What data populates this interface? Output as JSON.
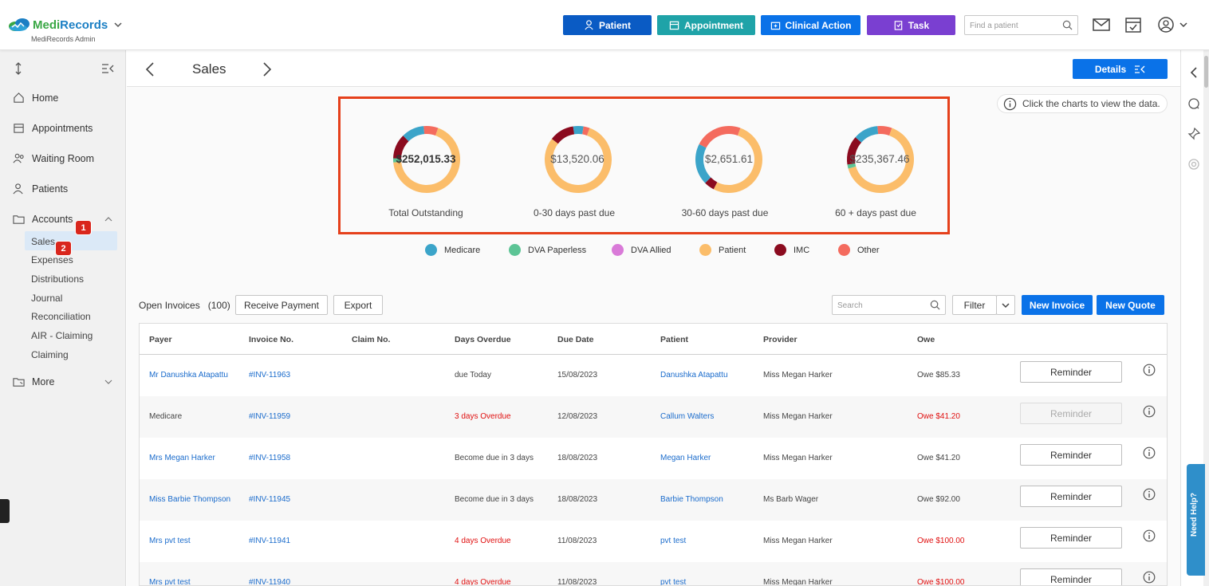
{
  "header": {
    "logo_text_medi": "Medi",
    "logo_text_records": "Records",
    "logo_subtitle": "MediRecords Admin",
    "buttons": {
      "patient": "Patient",
      "appointment": "Appointment",
      "clinical_action": "Clinical Action",
      "task": "Task"
    },
    "find_placeholder": "Find a patient",
    "colors": {
      "patient": "#0a5bc4",
      "appointment": "#1fa3a8",
      "clinical_action": "#0a72e8",
      "task": "#7a3fd1"
    }
  },
  "sidebar": {
    "items": {
      "home": "Home",
      "appointments": "Appointments",
      "waiting_room": "Waiting Room",
      "patients": "Patients",
      "accounts": "Accounts",
      "more": "More"
    },
    "accounts_sub": {
      "sales": "Sales",
      "expenses": "Expenses",
      "distributions": "Distributions",
      "journal": "Journal",
      "reconciliation": "Reconciliation",
      "air_claiming": "AIR - Claiming",
      "claiming": "Claiming"
    },
    "badges": {
      "one": "1",
      "two": "2"
    }
  },
  "page": {
    "title": "Sales",
    "details_label": "Details",
    "hint": "Click the charts to view the data."
  },
  "chart_data": [
    {
      "type": "pie",
      "title": "Total Outstanding",
      "center_label": "$252,015.33",
      "series": [
        {
          "name": "Patient",
          "value": 0.68
        },
        {
          "name": "DVA Paperless",
          "value": 0.02
        },
        {
          "name": "IMC",
          "value": 0.12
        },
        {
          "name": "Medicare",
          "value": 0.11
        },
        {
          "name": "Other",
          "value": 0.07
        }
      ]
    },
    {
      "type": "pie",
      "title": "0-30 days past due",
      "center_label": "$13,520.06",
      "series": [
        {
          "name": "Patient",
          "value": 0.8
        },
        {
          "name": "IMC",
          "value": 0.12
        },
        {
          "name": "Medicare",
          "value": 0.05
        },
        {
          "name": "Other",
          "value": 0.03
        }
      ]
    },
    {
      "type": "pie",
      "title": "30-60 days past due",
      "center_label": "$2,651.61",
      "series": [
        {
          "name": "Patient",
          "value": 0.52
        },
        {
          "name": "IMC",
          "value": 0.05
        },
        {
          "name": "Medicare",
          "value": 0.2
        },
        {
          "name": "Other",
          "value": 0.23
        }
      ]
    },
    {
      "type": "pie",
      "title": "60 + days past due",
      "center_label": "$235,367.46",
      "series": [
        {
          "name": "Patient",
          "value": 0.65
        },
        {
          "name": "DVA Paperless",
          "value": 0.02
        },
        {
          "name": "IMC",
          "value": 0.14
        },
        {
          "name": "Medicare",
          "value": 0.12
        },
        {
          "name": "Other",
          "value": 0.07
        }
      ]
    }
  ],
  "legend": [
    {
      "name": "Medicare",
      "color": "#3ba4c9"
    },
    {
      "name": "DVA Paperless",
      "color": "#5cc495"
    },
    {
      "name": "DVA Allied",
      "color": "#d97ad8"
    },
    {
      "name": "Patient",
      "color": "#fbbd6a"
    },
    {
      "name": "IMC",
      "color": "#8b0b1f"
    },
    {
      "name": "Other",
      "color": "#f46b5e"
    }
  ],
  "invoices": {
    "label": "Open Invoices",
    "count": "(100)",
    "receive_payment": "Receive Payment",
    "export": "Export",
    "search_placeholder": "Search",
    "filter": "Filter",
    "new_invoice": "New Invoice",
    "new_quote": "New Quote",
    "columns": [
      "Payer",
      "Invoice No.",
      "Claim No.",
      "Days Overdue",
      "Due Date",
      "Patient",
      "Provider",
      "Owe"
    ],
    "reminder": "Reminder",
    "rows": [
      {
        "payer": "Mr Danushka Atapattu",
        "payer_link": true,
        "invoice": "#INV-11963",
        "claim": "",
        "days": "due Today",
        "days_red": false,
        "due": "15/08/2023",
        "patient": "Danushka Atapattu",
        "provider": "Miss Megan Harker",
        "owe": "Owe $85.33",
        "owe_red": false,
        "reminder_disabled": false
      },
      {
        "payer": "Medicare",
        "payer_link": false,
        "invoice": "#INV-11959",
        "claim": "",
        "days": "3 days Overdue",
        "days_red": true,
        "due": "12/08/2023",
        "patient": "Callum Walters",
        "provider": "Miss Megan Harker",
        "owe": "Owe $41.20",
        "owe_red": true,
        "reminder_disabled": true
      },
      {
        "payer": "Mrs Megan Harker",
        "payer_link": true,
        "invoice": "#INV-11958",
        "claim": "",
        "days": "Become due in 3 days",
        "days_red": false,
        "due": "18/08/2023",
        "patient": "Megan Harker",
        "provider": "Miss Megan Harker",
        "owe": "Owe $41.20",
        "owe_red": false,
        "reminder_disabled": false
      },
      {
        "payer": "Miss Barbie Thompson",
        "payer_link": true,
        "invoice": "#INV-11945",
        "claim": "",
        "days": "Become due in 3 days",
        "days_red": false,
        "due": "18/08/2023",
        "patient": "Barbie Thompson",
        "provider": "Ms Barb Wager",
        "owe": "Owe $92.00",
        "owe_red": false,
        "reminder_disabled": false
      },
      {
        "payer": "Mrs pvt test",
        "payer_link": true,
        "invoice": "#INV-11941",
        "claim": "",
        "days": "4 days Overdue",
        "days_red": true,
        "due": "11/08/2023",
        "patient": "pvt test",
        "provider": "Miss Megan Harker",
        "owe": "Owe $100.00",
        "owe_red": true,
        "reminder_disabled": false
      },
      {
        "payer": "Mrs pvt test",
        "payer_link": true,
        "invoice": "#INV-11940",
        "claim": "",
        "days": "4 days Overdue",
        "days_red": true,
        "due": "11/08/2023",
        "patient": "pvt test",
        "provider": "Miss Megan Harker",
        "owe": "Owe $100.00",
        "owe_red": true,
        "reminder_disabled": false
      }
    ]
  },
  "need_help": "Need Help?"
}
